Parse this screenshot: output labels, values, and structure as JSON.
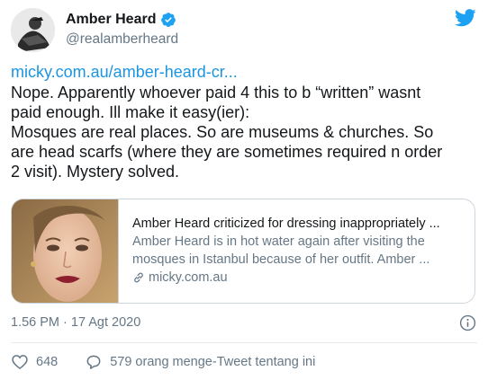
{
  "author": {
    "name": "Amber Heard",
    "handle": "@realamberheard"
  },
  "tweet": {
    "link_text": "micky.com.au/amber-heard-cr...",
    "line1": "Nope. Apparently whoever paid 4 this to b “written” wasnt",
    "line2": "paid enough.  Ill make it easy(ier):",
    "line3": "Mosques are real places. So are museums & churches. So",
    "line4": "are head scarfs (where they are sometimes required n order",
    "line5": "2 visit). Mystery solved."
  },
  "card": {
    "title": "Amber Heard criticized for dressing inappropriately ...",
    "desc_line1": "Amber Heard is in hot water again after visiting the",
    "desc_line2": "mosques in Istanbul because of her outfit. Amber ...",
    "domain": "micky.com.au"
  },
  "meta": {
    "timestamp": "1.56 PM · 17 Agt 2020"
  },
  "actions": {
    "likes": "648",
    "retweets_text": "579 orang menge-Tweet tentang ini"
  },
  "colors": {
    "accent": "#1b95e0",
    "text": "#14171a",
    "muted": "#657786",
    "border": "#ccd6dd",
    "verified": "#1da1f2"
  },
  "icons": [
    "verified-badge-icon",
    "twitter-bird-icon",
    "link-icon",
    "info-icon",
    "heart-icon",
    "speech-bubble-icon"
  ]
}
